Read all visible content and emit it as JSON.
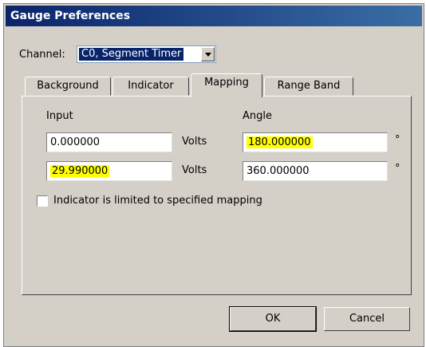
{
  "window": {
    "title": "Gauge Preferences"
  },
  "channel": {
    "label": "Channel:",
    "selected": "C0, Segment Timer"
  },
  "tabs": [
    {
      "label": "Background"
    },
    {
      "label": "Indicator"
    },
    {
      "label": "Mapping"
    },
    {
      "label": "Range Band"
    }
  ],
  "active_tab": "Mapping",
  "mapping": {
    "input_header": "Input",
    "angle_header": "Angle",
    "rows": [
      {
        "input": "0.000000",
        "input_unit": "Volts",
        "angle": "180.000000",
        "angle_unit": "°"
      },
      {
        "input": "29.990000",
        "input_unit": "Volts",
        "angle": "360.000000",
        "angle_unit": "°"
      }
    ],
    "limit_checkbox": {
      "label": "Indicator is limited to specified mapping",
      "checked": false
    }
  },
  "buttons": {
    "ok": "OK",
    "cancel": "Cancel"
  },
  "colors": {
    "highlight": "#ffff00",
    "title_bar": "#0a246a"
  }
}
